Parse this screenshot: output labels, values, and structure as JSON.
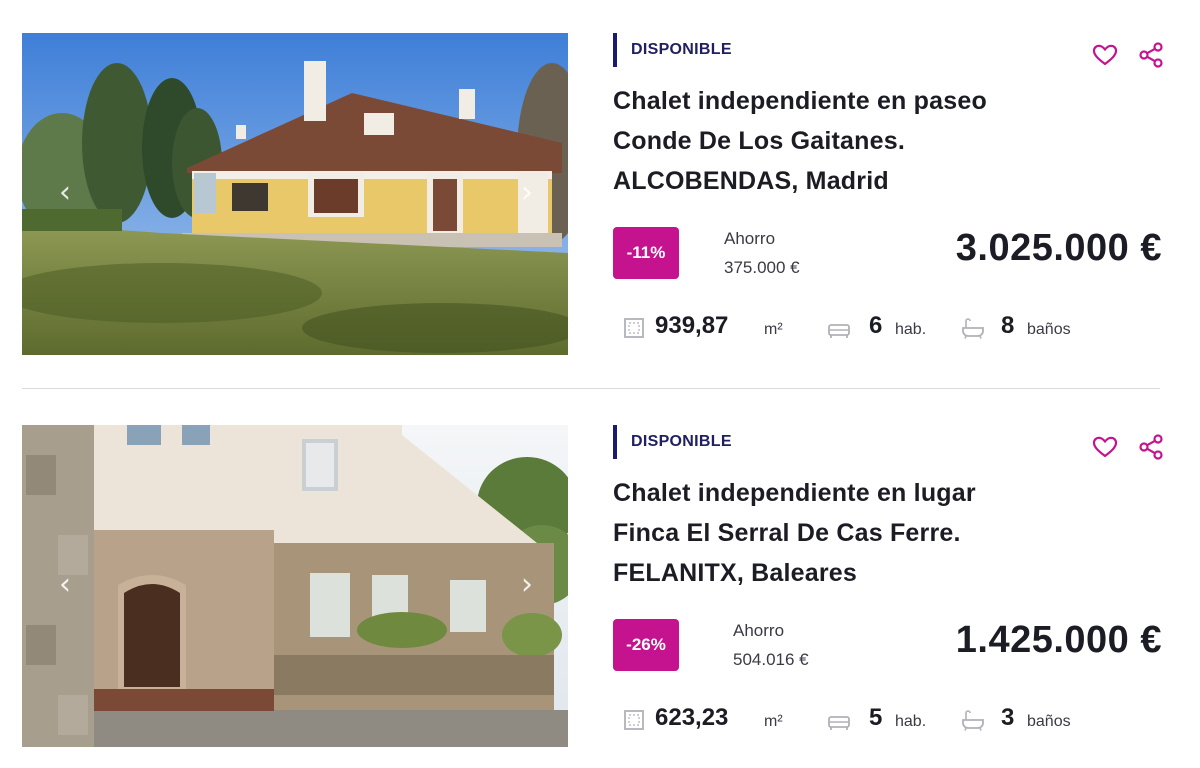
{
  "listings": [
    {
      "status": "DISPONIBLE",
      "title_lines": [
        "Chalet independiente en paseo",
        "Conde De Los Gaitanes.",
        "ALCOBENDAS, Madrid"
      ],
      "discount": "-11%",
      "savings_label": "Ahorro",
      "savings_value": "375.000 €",
      "price": "3.025.000 €",
      "area_value": "939,87",
      "area_unit": "m²",
      "rooms_value": "6",
      "rooms_unit": "hab.",
      "baths_value": "8",
      "baths_unit": "baños",
      "photo_scene": "house-yellow-garden"
    },
    {
      "status": "DISPONIBLE",
      "title_lines": [
        "Chalet independiente en lugar",
        "Finca El Serral De Cas Ferre.",
        "FELANITX, Baleares"
      ],
      "discount": "-26%",
      "savings_label": "Ahorro",
      "savings_value": "504.016 €",
      "price": "1.425.000 €",
      "area_value": "623,23",
      "area_unit": "m²",
      "rooms_value": "5",
      "rooms_unit": "hab.",
      "baths_value": "3",
      "baths_unit": "baños",
      "photo_scene": "stone-house-arched-door"
    }
  ],
  "icons": {
    "favorite": "heart-outline-icon",
    "share": "share-icon",
    "area": "floor-plan-icon",
    "rooms": "bed-icon",
    "baths": "bathtub-icon",
    "prev": "chevron-left-icon",
    "next": "chevron-right-icon"
  },
  "colors": {
    "accent": "#c5138f",
    "status_bar": "#1a1a6e",
    "text": "#1c1c24",
    "icon_pink": "#c5138f"
  }
}
